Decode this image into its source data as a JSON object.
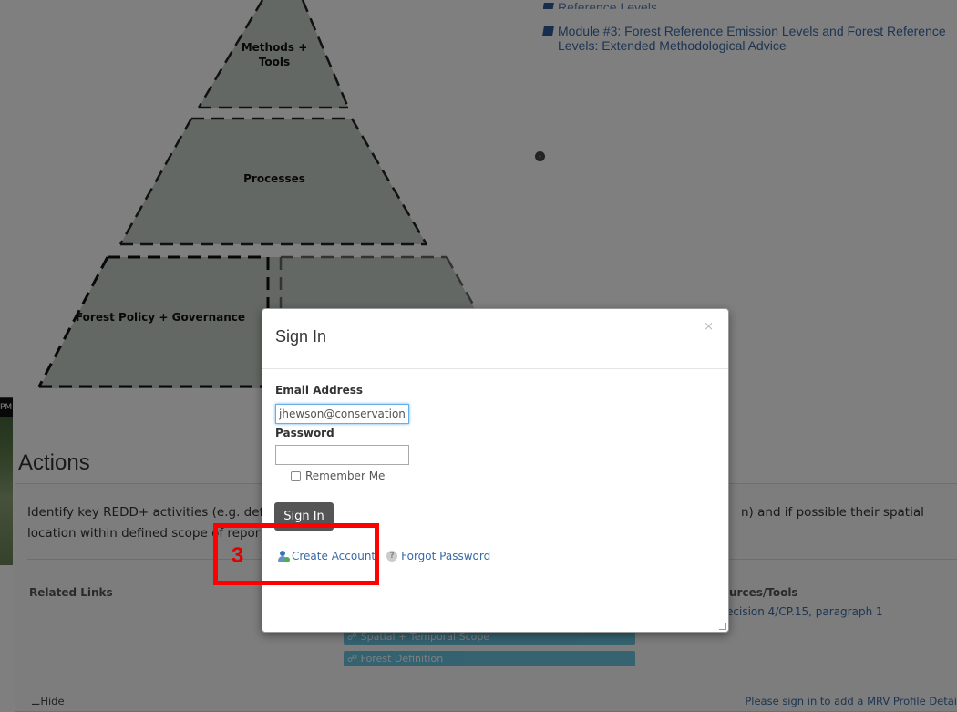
{
  "overlay_tab_text": "PM",
  "pyramid": {
    "top_label": [
      "Methods +",
      "Tools"
    ],
    "middle_label": "Processes",
    "bottom_label": "Forest Policy + Governance"
  },
  "resources": {
    "partial_item": "Reference Levels",
    "module_line1": "Module #3: Forest Reference Emission Levels and Forest Reference",
    "module_line2": "Levels: Extended Methodological Advice"
  },
  "collapse_icon": "chevron-left-circle-icon",
  "actions": {
    "title": "Actions",
    "text_start": "Identify key REDD+ activities (e.g. defo",
    "text_end": "n) and if possible their spatial",
    "text_line2": "location within defined scope of repor",
    "related_links_label": "Related Links",
    "sources_label": "urces/Tools",
    "source_link": "ecision 4/CP.15, paragraph 1",
    "tags": [
      "Spatial + Temporal Scope",
      "Forest Definition"
    ],
    "hide_label": "Hide",
    "signin_note": "Please sign in to add a MRV Profile Detai"
  },
  "modal": {
    "title": "Sign In",
    "close_glyph": "×",
    "email_label": "Email Address",
    "email_value": "jhewson@conservation.or",
    "password_label": "Password",
    "password_value": "",
    "remember_label": "Remember Me",
    "remember_checked": false,
    "submit_label": "Sign In",
    "create_account_label": "Create Account",
    "forgot_password_label": "Forgot Password"
  },
  "callout": {
    "number": "3",
    "color": "#ff0000"
  },
  "colors": {
    "pyramid_fill": "#c9d0c8",
    "link": "#3a6aa6",
    "tag": "#5bc0de",
    "button": "#555555"
  }
}
